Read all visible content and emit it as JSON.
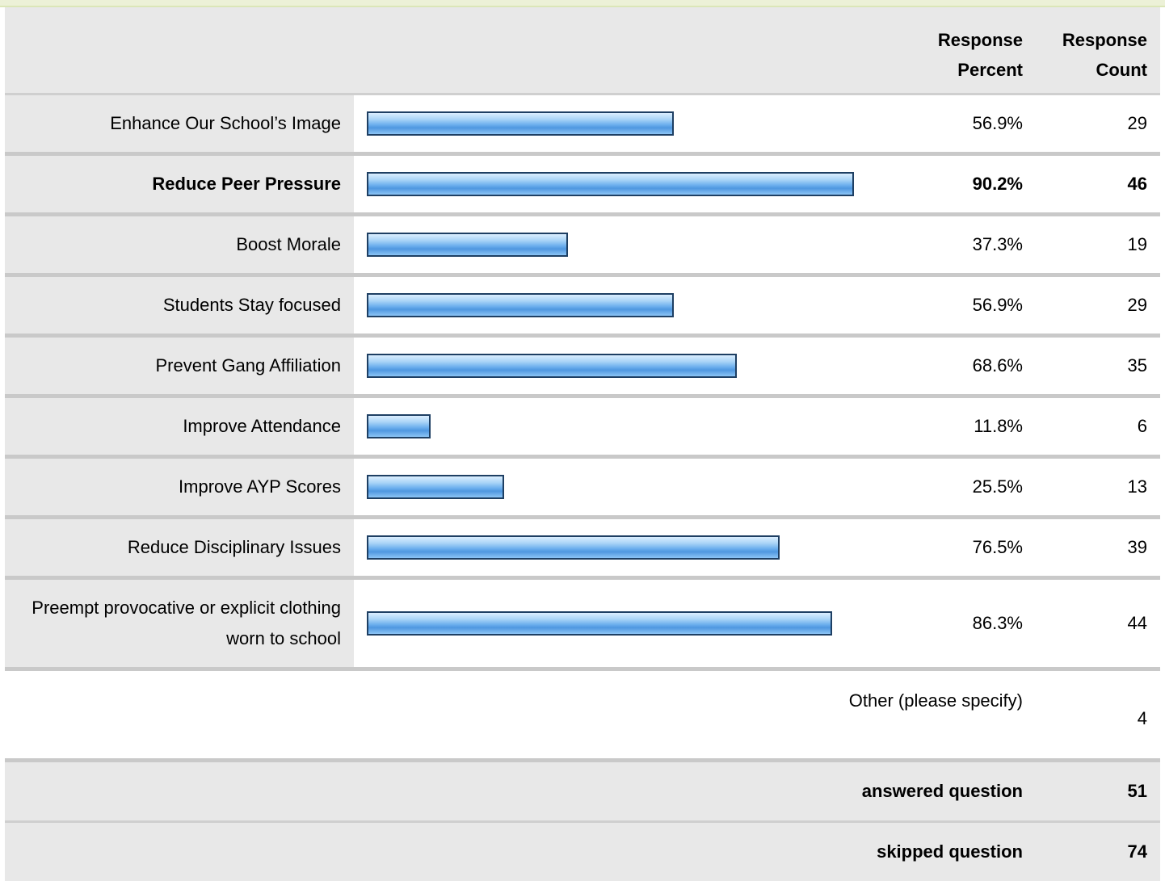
{
  "header": {
    "percent_label": "Response\nPercent",
    "count_label": "Response\nCount"
  },
  "rows": [
    {
      "label": "Enhance Our School’s Image",
      "percent": "56.9%",
      "count": "29",
      "fraction": 0.569
    },
    {
      "label": "Reduce Peer Pressure",
      "percent": "90.2%",
      "count": "46",
      "fraction": 0.902
    },
    {
      "label": "Boost Morale",
      "percent": "37.3%",
      "count": "19",
      "fraction": 0.373
    },
    {
      "label": "Students Stay focused",
      "percent": "56.9%",
      "count": "29",
      "fraction": 0.569
    },
    {
      "label": "Prevent Gang Affiliation",
      "percent": "68.6%",
      "count": "35",
      "fraction": 0.686
    },
    {
      "label": "Improve Attendance",
      "percent": "11.8%",
      "count": "6",
      "fraction": 0.118
    },
    {
      "label": "Improve AYP Scores",
      "percent": "25.5%",
      "count": "13",
      "fraction": 0.255
    },
    {
      "label": "Reduce Disciplinary Issues",
      "percent": "76.5%",
      "count": "39",
      "fraction": 0.765
    },
    {
      "label": "Preempt provocative or explicit clothing worn to school",
      "percent": "86.3%",
      "count": "44",
      "fraction": 0.863
    }
  ],
  "other": {
    "label": "Other (please specify)",
    "count": "4"
  },
  "footer": {
    "answered_label": "answered question",
    "answered_value": "51",
    "skipped_label": "skipped question",
    "skipped_value": "74"
  },
  "colors": {
    "bar_border": "#1e3f63",
    "bar_fill": "#6eb0ee",
    "label_bg": "#e8e8e8"
  }
}
